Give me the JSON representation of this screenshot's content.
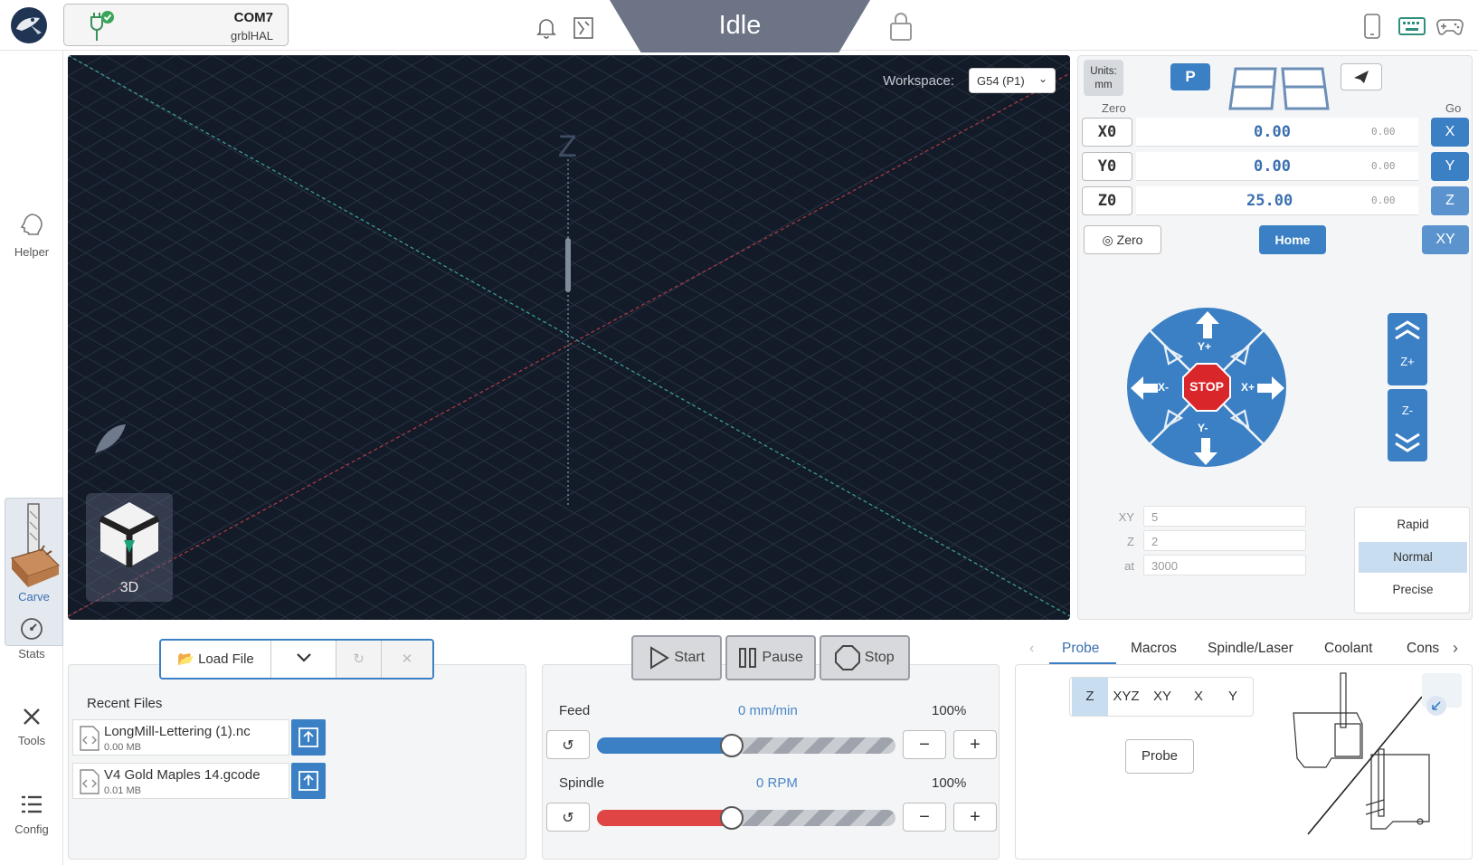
{
  "header": {
    "connection": {
      "port": "COM7",
      "firmware": "grblHAL"
    },
    "status": "Idle"
  },
  "sidebar": {
    "items": [
      {
        "label": "Helper",
        "icon": "helper-icon"
      },
      {
        "label": "Carve",
        "icon": "carve-icon"
      },
      {
        "label": "Stats",
        "icon": "gauge-icon"
      },
      {
        "label": "Tools",
        "icon": "tools-icon"
      },
      {
        "label": "Config",
        "icon": "list-icon"
      }
    ]
  },
  "visualizer": {
    "workspace_label": "Workspace:",
    "workspace_value": "G54 (P1)",
    "axis_z_label": "Z",
    "view_label": "3D"
  },
  "dro": {
    "units": "Units:",
    "units_value": "mm",
    "profile_button": "P",
    "zero_header": "Zero",
    "go_header": "Go",
    "axes": [
      {
        "zero": "X0",
        "work": "0.00",
        "machine": "0.00",
        "go": "X"
      },
      {
        "zero": "Y0",
        "work": "0.00",
        "machine": "0.00",
        "go": "Y"
      },
      {
        "zero": "Z0",
        "work": "25.00",
        "machine": "0.00",
        "go": "Z"
      }
    ],
    "zero_all": "Zero",
    "home": "Home",
    "go_xy": "XY"
  },
  "jog": {
    "stop": "STOP",
    "x_minus": "X-",
    "x_plus": "X+",
    "y_plus": "Y+",
    "y_minus": "Y-",
    "z_plus": "Z+",
    "z_minus": "Z-",
    "xy_label": "XY",
    "xy_value": "5",
    "z_label": "Z",
    "z_value": "2",
    "at_label": "at",
    "at_value": "3000",
    "speeds": [
      "Rapid",
      "Normal",
      "Precise"
    ],
    "selected_speed": "Normal"
  },
  "files": {
    "load_button": "Load File",
    "recent_title": "Recent Files",
    "recent": [
      {
        "name": "LongMill-Lettering (1).nc",
        "size": "0.00 MB"
      },
      {
        "name": "V4 Gold Maples 14.gcode",
        "size": "0.01 MB"
      }
    ]
  },
  "run": {
    "start": "Start",
    "pause": "Pause",
    "stop": "Stop",
    "feed_label": "Feed",
    "feed_value": "0 mm/min",
    "feed_pct": "100%",
    "feed_fraction": 0.45,
    "spindle_label": "Spindle",
    "spindle_value": "0 RPM",
    "spindle_pct": "100%",
    "spindle_fraction": 0.45,
    "minus": "−",
    "plus": "+"
  },
  "tools_tabs": {
    "tabs": [
      "Probe",
      "Macros",
      "Spindle/Laser",
      "Coolant",
      "Cons"
    ],
    "active": "Probe",
    "probe_axes": [
      "Z",
      "XYZ",
      "XY",
      "X",
      "Y"
    ],
    "selected_axis": "Z",
    "probe_button": "Probe"
  },
  "colors": {
    "accent": "#3b80c4",
    "status_bg": "#6c7486",
    "viz_bg": "#141b28",
    "stop_red": "#d9262b",
    "spindle_red": "#e04545"
  }
}
